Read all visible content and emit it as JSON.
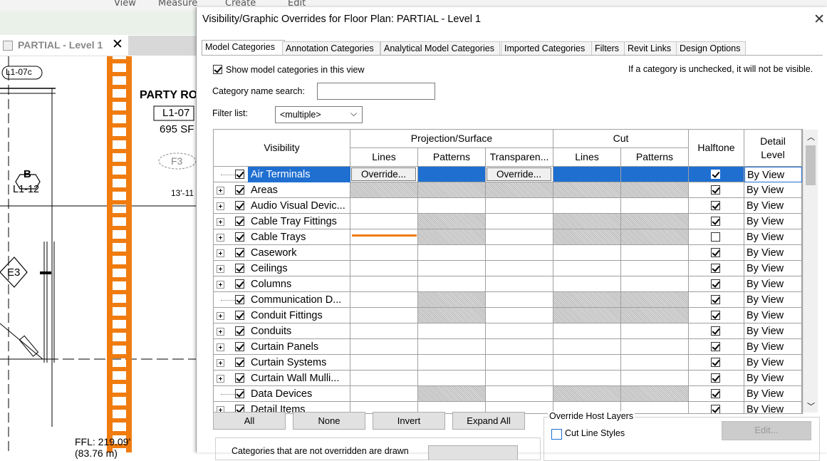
{
  "ribbon": {
    "view": "View",
    "measure": "Measure",
    "create": "Create",
    "edit": "Edit"
  },
  "view_tab": {
    "label": "PARTIAL - Level 1"
  },
  "drawing": {
    "tag1": "L1-07c",
    "party": "PARTY RO",
    "room_num": "L1-07",
    "area": "695 SF",
    "f3": "F3",
    "b": "B",
    "l112": "L1-12",
    "dim": "13'-11",
    "e3": "E3",
    "ffl": "FFL: 219.09'",
    "ffl2": "(83.76 m)"
  },
  "dialog": {
    "title": "Visibility/Graphic Overrides for Floor Plan: PARTIAL - Level 1",
    "tabs": [
      "Model Categories",
      "Annotation Categories",
      "Analytical Model Categories",
      "Imported Categories",
      "Filters",
      "Revit Links",
      "Design Options"
    ],
    "show_label": "Show model categories in this view",
    "note": "If a category is unchecked, it will not be visible.",
    "search_label": "Category name search:",
    "search_value": "",
    "filter_label": "Filter list:",
    "filter_value": "<multiple>",
    "headers": {
      "visibility": "Visibility",
      "projection": "Projection/Surface",
      "cut": "Cut",
      "halftone": "Halftone",
      "detail": "Detail Level",
      "lines": "Lines",
      "patterns": "Patterns",
      "transparency": "Transparen...",
      "cut_lines": "Lines",
      "cut_patterns": "Patterns"
    },
    "override_label": "Override...",
    "rows": [
      {
        "name": "Air Terminals",
        "halftone": true,
        "detail": "By View"
      },
      {
        "name": "Areas",
        "halftone": true,
        "detail": "By View"
      },
      {
        "name": "Audio Visual Devic...",
        "halftone": true,
        "detail": "By View"
      },
      {
        "name": "Cable Tray Fittings",
        "halftone": true,
        "detail": "By View"
      },
      {
        "name": "Cable Trays",
        "halftone": false,
        "detail": "By View"
      },
      {
        "name": "Casework",
        "halftone": true,
        "detail": "By View"
      },
      {
        "name": "Ceilings",
        "halftone": true,
        "detail": "By View"
      },
      {
        "name": "Columns",
        "halftone": true,
        "detail": "By View"
      },
      {
        "name": "Communication D...",
        "halftone": true,
        "detail": "By View"
      },
      {
        "name": "Conduit Fittings",
        "halftone": true,
        "detail": "By View"
      },
      {
        "name": "Conduits",
        "halftone": true,
        "detail": "By View"
      },
      {
        "name": "Curtain Panels",
        "halftone": true,
        "detail": "By View"
      },
      {
        "name": "Curtain Systems",
        "halftone": true,
        "detail": "By View"
      },
      {
        "name": "Curtain Wall Mulli...",
        "halftone": true,
        "detail": "By View"
      },
      {
        "name": "Data Devices",
        "halftone": true,
        "detail": "By View"
      },
      {
        "name": "Detail Items",
        "halftone": true,
        "detail": "By View"
      }
    ],
    "buttons": {
      "all": "All",
      "none": "None",
      "invert": "Invert",
      "expand": "Expand All",
      "edit": "Edit..."
    },
    "host_layers": {
      "title": "Override Host Layers",
      "cut_line": "Cut Line Styles"
    },
    "bottom_note": "Categories that are not overridden are drawn"
  },
  "colors": {
    "accent_orange": "#f07c10",
    "selection_blue": "#1f6fd1"
  }
}
